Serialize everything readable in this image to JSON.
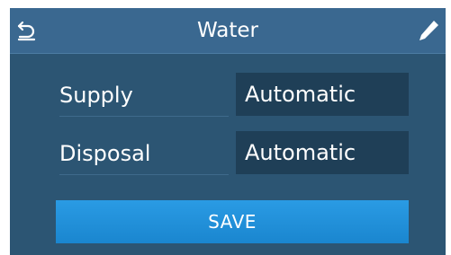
{
  "header": {
    "title": "Water",
    "back_icon": "back-arrow-icon",
    "edit_icon": "pencil-icon"
  },
  "rows": [
    {
      "label": "Supply",
      "value": "Automatic"
    },
    {
      "label": "Disposal",
      "value": "Automatic"
    }
  ],
  "actions": {
    "save_label": "SAVE"
  },
  "colors": {
    "background": "#2c5573",
    "header": "#3a6890",
    "value_box": "#1f3f57",
    "save_button": "#1f8fd8"
  }
}
